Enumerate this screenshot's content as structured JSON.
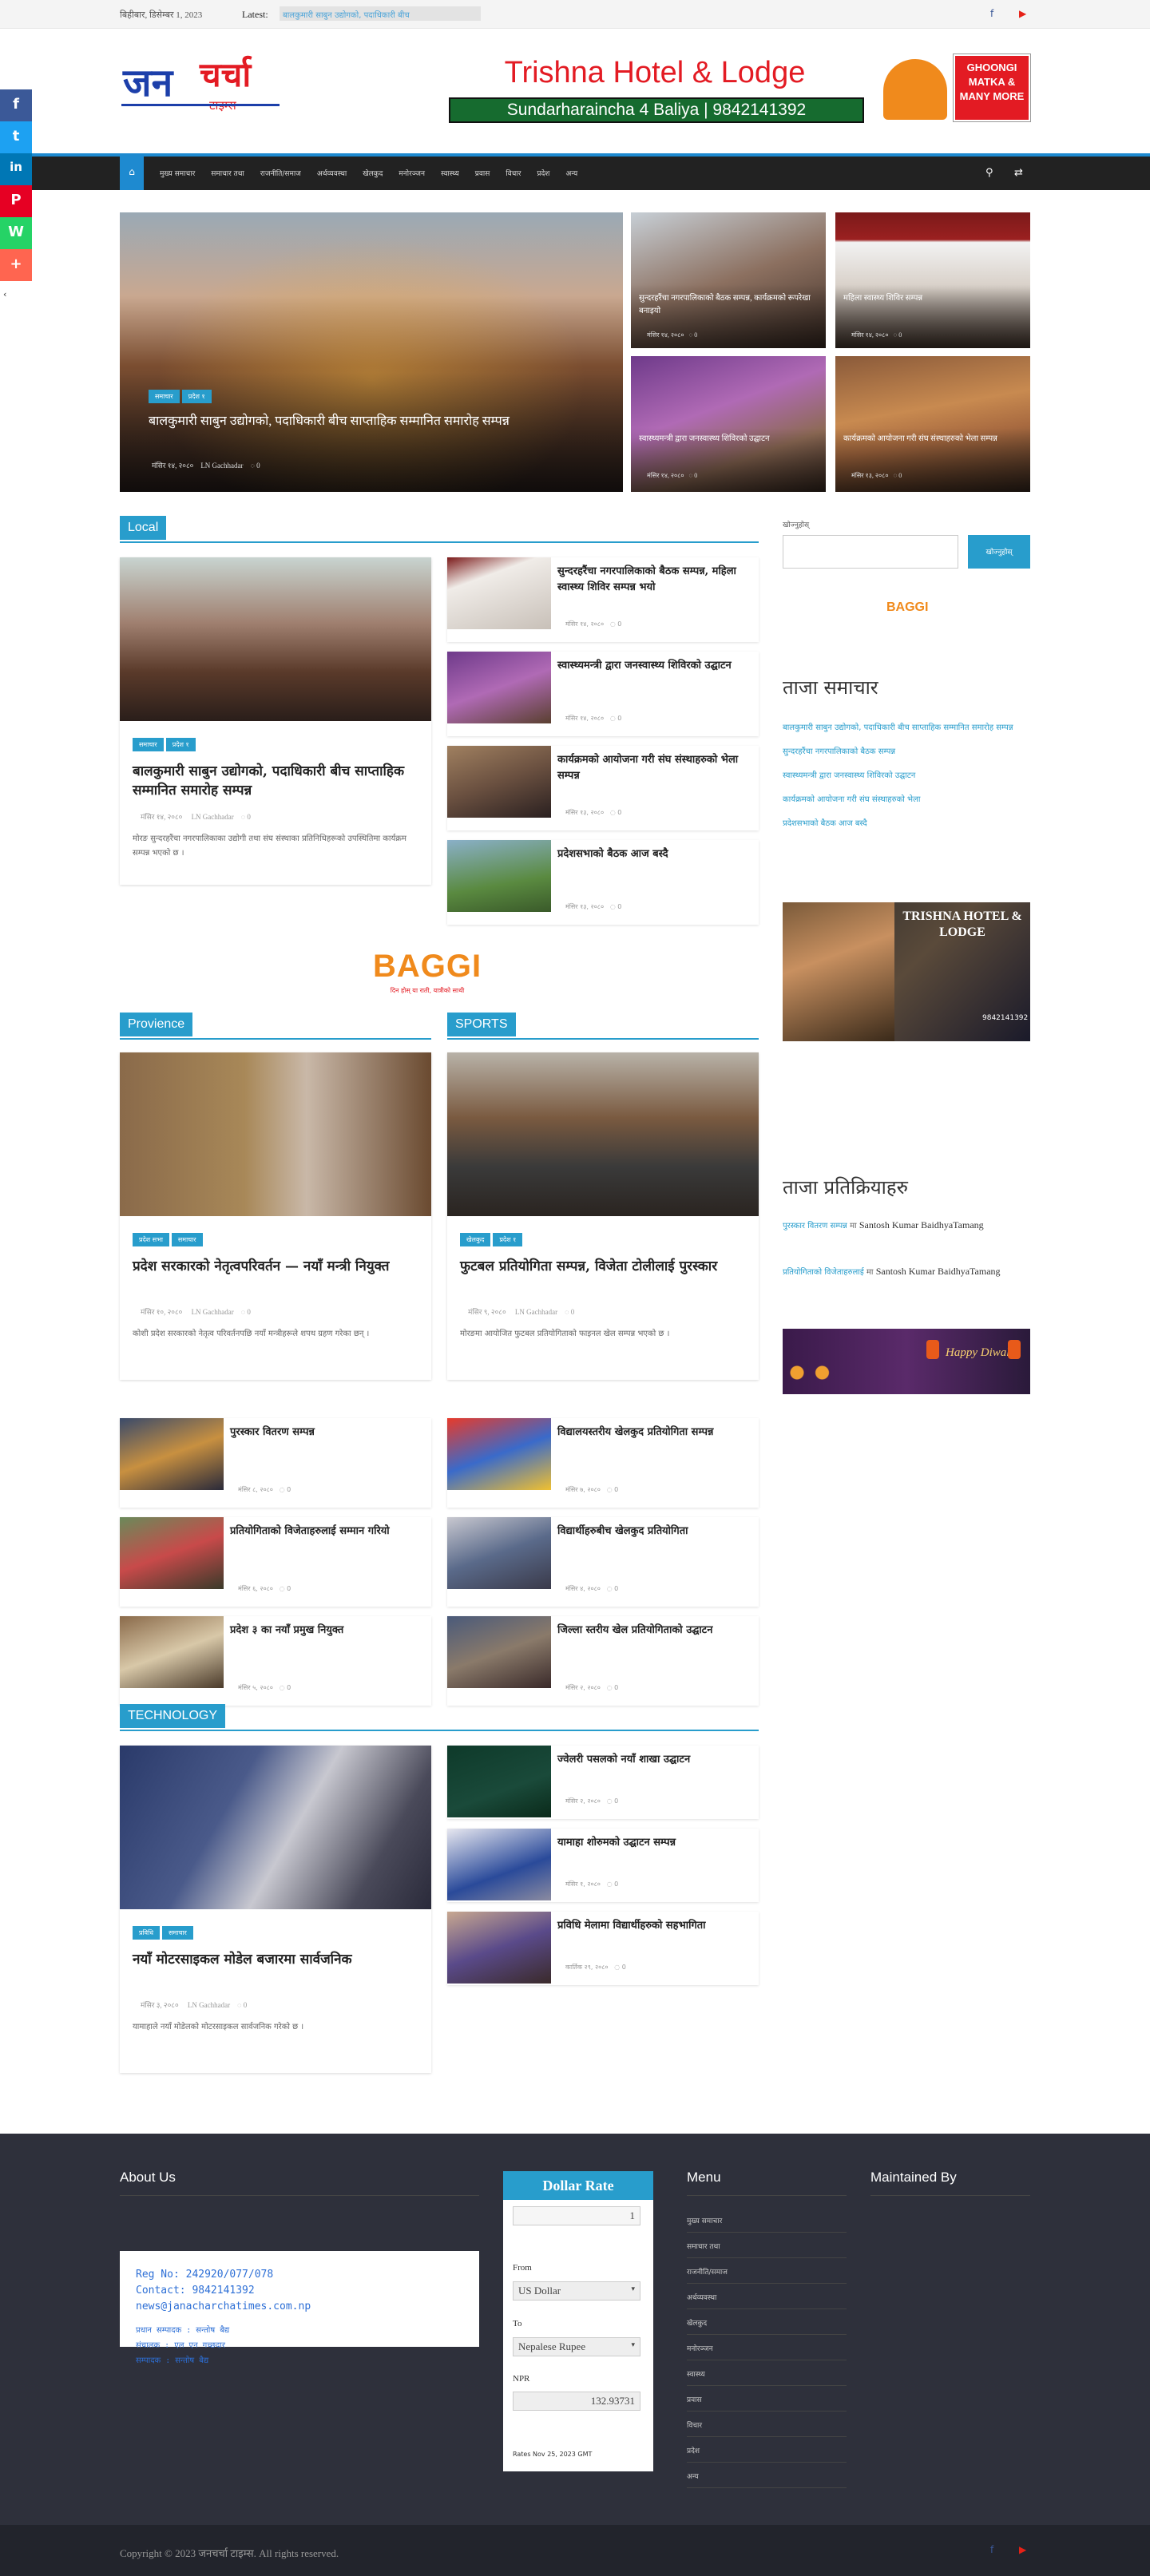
{
  "topbar": {
    "date": "बिहीबार, डिसेम्बर 1, 2023",
    "latest_label": "Latest:",
    "ticker": "बालकुमारी साबुन उद्योगको, पदाधिकारी बीच"
  },
  "header": {
    "logo_main": "जन",
    "logo_accent": "चर्चा",
    "logo_sub": "टाइम्स",
    "banner_title": "Trishna Hotel & Lodge",
    "banner_sub": "Sundarharaincha 4 Baliya | 9842141392",
    "banner_badge": "GHOONGI MATKA & MANY MORE"
  },
  "nav": {
    "items": [
      "मुख्य समाचार",
      "समाचार तथा",
      "राजनीति/समाज",
      "अर्थव्यवस्था",
      "खेलकुद",
      "मनोरञ्जन",
      "स्वास्थ्य",
      "प्रवास",
      "विचार",
      "प्रदेश",
      "अन्य"
    ]
  },
  "share": [
    "f",
    "t",
    "in",
    "P",
    "W",
    "+"
  ],
  "slider": {
    "main": {
      "tags": [
        "समाचार",
        "प्रदेश १"
      ],
      "title": "बालकुमारी साबुन उद्योगको, पदाधिकारी बीच साप्ताहिक सम्मानित समारोह सम्पन्न",
      "date": "मंसिर १४, २०८०",
      "author": "LN Gachhadar",
      "comments": "0"
    },
    "small": [
      {
        "title": "सुन्दरहरैंचा नगरपालिकाको बैठक सम्पन्न, कार्यक्रमको रूपरेखा बनाइयो",
        "date": "मंसिर १४, २०८०",
        "comments": "0"
      },
      {
        "title": "महिला स्वास्थ्य शिविर सम्पन्न",
        "date": "मंसिर १४, २०८०",
        "comments": "0"
      },
      {
        "title": "स्वास्थ्यमन्त्री द्वारा जनस्वास्थ्य शिविरको उद्घाटन",
        "date": "मंसिर १४, २०८०",
        "comments": "0"
      },
      {
        "title": "कार्यक्रमको आयोजना गरी संघ संस्थाहरुको भेला सम्पन्न",
        "date": "मंसिर १३, २०८०",
        "comments": "0"
      }
    ]
  },
  "local": {
    "label": "Local",
    "main": {
      "tags": [
        "समाचार",
        "प्रदेश १"
      ],
      "title": "बालकुमारी साबुन उद्योगको, पदाधिकारी बीच साप्ताहिक सम्मानित समारोह सम्पन्न",
      "date": "मंसिर १४, २०८०",
      "author": "LN Gachhadar",
      "comments": "0",
      "excerpt": "मोरङ सुन्दरहरैंचा नगरपालिकाका उद्योगी तथा संघ संस्थाका प्रतिनिधिहरूको उपस्थितिमा कार्यक्रम सम्पन्न भएको छ ।"
    },
    "list": [
      {
        "title": "सुन्दरहरैंचा नगरपालिकाको बैठक सम्पन्न, महिला स्वास्थ्य शिविर सम्पन्न भयो",
        "date": "मंसिर १४, २०८०",
        "comments": "0"
      },
      {
        "title": "स्वास्थ्यमन्त्री द्वारा जनस्वास्थ्य शिविरको उद्घाटन",
        "date": "मंसिर १४, २०८०",
        "comments": "0"
      },
      {
        "title": "कार्यक्रमको आयोजना गरी संघ संस्थाहरुको भेला सम्पन्न",
        "date": "मंसिर १३, २०८०",
        "comments": "0"
      },
      {
        "title": "प्रदेशसभाको बैठक आज बस्दै",
        "date": "मंसिर १३, २०८०",
        "comments": "0"
      }
    ]
  },
  "ad_mid": {
    "brand": "BAGGI",
    "tagline": "दिन होस् या राती, यात्रीको साथी"
  },
  "province": {
    "label": "Provience",
    "main": {
      "tags": [
        "प्रदेश सभा",
        "समाचार"
      ],
      "title": "प्रदेश सरकारको नेतृत्वपरिवर्तन — नयाँ मन्त्री नियुक्त",
      "date": "मंसिर १०, २०८०",
      "author": "LN Gachhadar",
      "comments": "0",
      "excerpt": "कोशी प्रदेश सरकारको नेतृत्व परिवर्तनपछि नयाँ मन्त्रीहरूले शपथ ग्रहण गरेका छन् ।"
    },
    "list": [
      {
        "title": "पुरस्कार वितरण सम्पन्न",
        "date": "मंसिर ८, २०८०",
        "comments": "0"
      },
      {
        "title": "प्रतियोगिताको विजेताहरुलाई सम्मान गरियो",
        "date": "मंसिर ६, २०८०",
        "comments": "0"
      },
      {
        "title": "प्रदेश ३ का नयाँ प्रमुख नियुक्त",
        "date": "मंसिर ५, २०८०",
        "comments": "0"
      }
    ]
  },
  "sports": {
    "label": "SPORTS",
    "main": {
      "tags": [
        "खेलकुद",
        "प्रदेश १"
      ],
      "title": "फुटबल प्रतियोगिता सम्पन्न, विजेता टोलीलाई पुरस्कार",
      "date": "मंसिर ९, २०८०",
      "author": "LN Gachhadar",
      "comments": "0",
      "excerpt": "मोरङमा आयोजित फुटबल प्रतियोगिताको फाइनल खेल सम्पन्न भएको छ ।"
    },
    "list": [
      {
        "title": "विद्यालयस्तरीय खेलकुद प्रतियोगिता सम्पन्न",
        "date": "मंसिर ७, २०८०",
        "comments": "0"
      },
      {
        "title": "विद्यार्थीहरुबीच खेलकुद प्रतियोगिता",
        "date": "मंसिर ४, २०८०",
        "comments": "0"
      },
      {
        "title": "जिल्ला स्तरीय खेल प्रतियोगिताको उद्घाटन",
        "date": "मंसिर २, २०८०",
        "comments": "0"
      }
    ]
  },
  "technology": {
    "label": "TECHNOLOGY",
    "main": {
      "tags": [
        "प्रविधि",
        "समाचार"
      ],
      "title": "नयाँ मोटरसाइकल मोडेल बजारमा सार्वजनिक",
      "date": "मंसिर ३, २०८०",
      "author": "LN Gachhadar",
      "comments": "0",
      "excerpt": "यामाहाले नयाँ मोडेलको मोटरसाइकल सार्वजनिक गरेको छ ।"
    },
    "list": [
      {
        "title": "ज्वेलरी पसलको नयाँ शाखा उद्घाटन",
        "date": "मंसिर २, २०८०",
        "comments": "0"
      },
      {
        "title": "यामाहा शोरुमको उद्घाटन सम्पन्न",
        "date": "मंसिर १, २०८०",
        "comments": "0"
      },
      {
        "title": "प्रविधि मेलामा विद्यार्थीहरुको सहभागिता",
        "date": "कार्तिक २९, २०८०",
        "comments": "0"
      }
    ]
  },
  "sidebar": {
    "search_label": "खोज्नुहोस्",
    "search_button": "खोज्नुहोस्",
    "recent_title": "ताजा समाचार",
    "recent": [
      "बालकुमारी साबुन उद्योगको, पदाधिकारी बीच साप्ताहिक सम्मानित समारोह सम्पन्न",
      "सुन्दरहरैंचा नगरपालिकाको बैठक सम्पन्न",
      "स्वास्थ्यमन्त्री द्वारा जनस्वास्थ्य शिविरको उद्घाटन",
      "कार्यक्रमको आयोजना गरी संघ संस्थाहरुको भेला",
      "प्रदेशसभाको बैठक आज बस्दै"
    ],
    "hotel_ad_title": "TRISHNA HOTEL & LODGE",
    "hotel_ad_phone": "9842141392",
    "comments_title": "ताजा प्रतिक्रियाहरु",
    "comments": [
      {
        "post": "पुरस्कार वितरण सम्पन्न",
        "on": "मा",
        "author": "Santosh Kumar BaidhyaTamang"
      },
      {
        "post": "प्रतियोगिताको विजेताहरुलाई",
        "on": "मा",
        "author": "Santosh Kumar BaidhyaTamang"
      }
    ],
    "diwali_text": "Happy Diwali"
  },
  "footer": {
    "about_title": "About Us",
    "about_lines": [
      "Reg No: 242920/077/078",
      "Contact: 9842141392",
      "news@janacharchatimes.com.np",
      "",
      "प्रधान सम्पादक : सन्तोष बैद्य",
      "संचालक : एल एन गच्छदार",
      "सम्पादक : सन्तोष बैद्य"
    ],
    "rate_title": "Dollar Rate",
    "rate_amount": "1",
    "rate_from_label": "From",
    "rate_from": "US Dollar",
    "rate_to_label": "To",
    "rate_to": "Nepalese Rupee",
    "rate_npr_label": "NPR",
    "rate_result": "132.93731",
    "rate_note": "Rates Nov 25, 2023 GMT",
    "menu_title": "Menu",
    "menu_items": [
      "मुख्य समाचार",
      "समाचार तथा",
      "राजनीति/समाज",
      "अर्थव्यवस्था",
      "खेलकुद",
      "मनोरञ्जन",
      "स्वास्थ्य",
      "प्रवास",
      "विचार",
      "प्रदेश",
      "अन्य"
    ],
    "maintained_title": "Maintained By",
    "copyright": "Copyright © 2023 जनचर्चा टाइम्स. All rights reserved."
  }
}
